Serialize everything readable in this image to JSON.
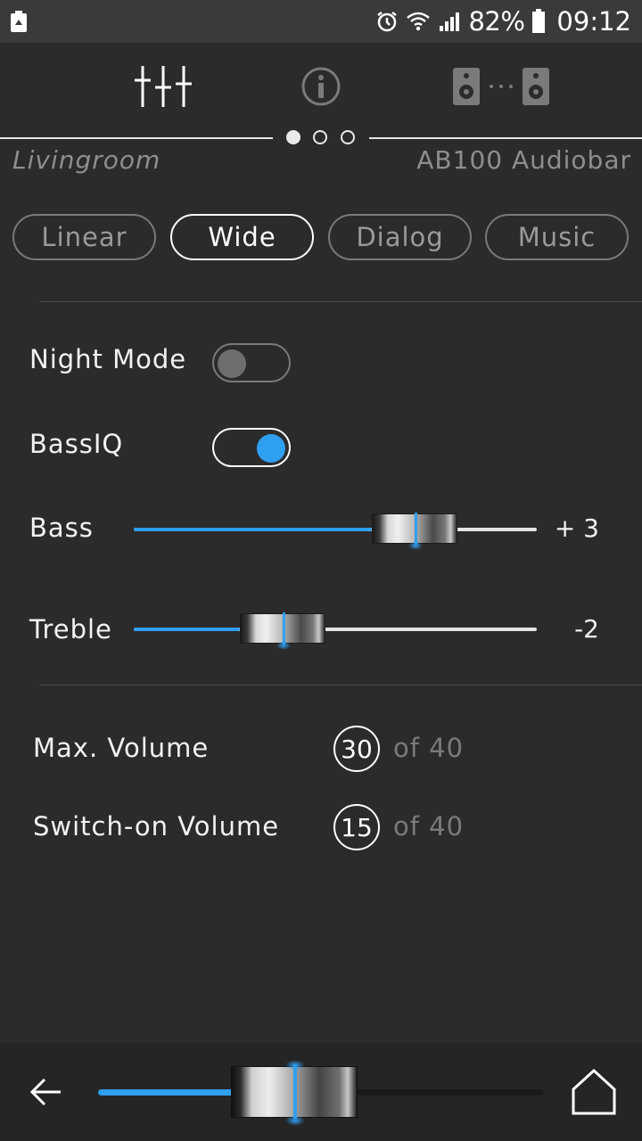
{
  "status_bar": {
    "battery_percent": "82%",
    "time": "09:12",
    "icons": [
      "recycle-battery-icon",
      "alarm-icon",
      "wifi-icon",
      "signal-icon",
      "battery-icon"
    ]
  },
  "nav": {
    "icons": [
      "equalizer-icon",
      "info-icon",
      "speakers-link-icon"
    ],
    "pager": {
      "pages": 3,
      "current": 1
    }
  },
  "device": {
    "room": "Livingroom",
    "model": "AB100 Audiobar"
  },
  "modes": {
    "items": [
      {
        "label": "Linear",
        "active": false
      },
      {
        "label": "Wide",
        "active": true
      },
      {
        "label": "Dialog",
        "active": false
      },
      {
        "label": "Music",
        "active": false
      }
    ]
  },
  "settings": {
    "night_mode": {
      "label": "Night Mode",
      "on": false
    },
    "bassiq": {
      "label": "BassIQ",
      "on": true
    },
    "bass": {
      "label": "Bass",
      "value_text": "+ 3",
      "value": 3,
      "min": -6,
      "max": 6
    },
    "treble": {
      "label": "Treble",
      "value_text": "-2",
      "value": -2,
      "min": -6,
      "max": 6
    }
  },
  "volume_limits": {
    "max_volume": {
      "label": "Max. Volume",
      "value": "30",
      "of": "of 40"
    },
    "switch_on_volume": {
      "label": "Switch-on Volume",
      "value": "15",
      "of": "of 40"
    }
  },
  "bottom_bar": {
    "volume_level": 0.44,
    "icons": [
      "back-arrow-icon",
      "home-icon"
    ]
  },
  "colors": {
    "accent": "#2f9ff0",
    "background": "#2b2b2c",
    "status_bar": "#3a3a3b",
    "bottom_bar": "#252526"
  }
}
